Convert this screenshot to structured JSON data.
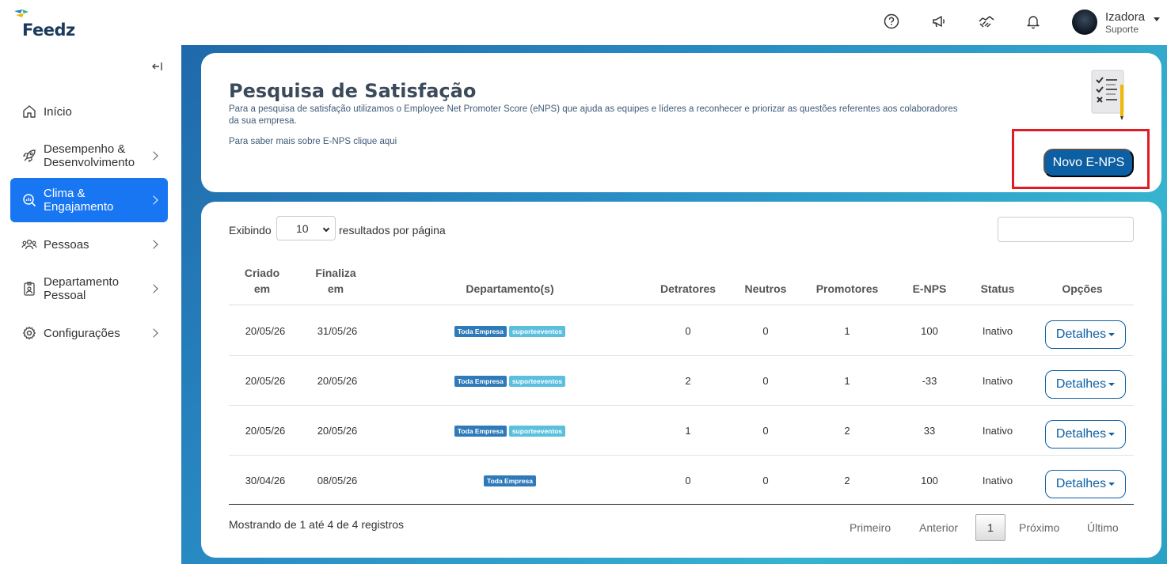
{
  "app": {
    "logo_text": "Feedz"
  },
  "header": {
    "icons": [
      "help-icon",
      "megaphone-icon",
      "handshake-icon",
      "bell-icon"
    ],
    "user": {
      "name": "Izadora",
      "role": "Suporte"
    }
  },
  "sidebar": {
    "collapse_icon": "collapse-left-icon",
    "items": [
      {
        "label": "Início",
        "icon": "home-icon",
        "active": false,
        "has_children": false
      },
      {
        "label": "Desempenho &\nDesenvolvimento",
        "icon": "rocket-icon",
        "active": false,
        "has_children": true
      },
      {
        "label": "Clima &\nEngajamento",
        "icon": "search-chart-icon",
        "active": true,
        "has_children": true
      },
      {
        "label": "Pessoas",
        "icon": "people-icon",
        "active": false,
        "has_children": true
      },
      {
        "label": "Departamento\nPessoal",
        "icon": "badge-icon",
        "active": false,
        "has_children": true
      },
      {
        "label": "Configurações",
        "icon": "gear-icon",
        "active": false,
        "has_children": true
      }
    ]
  },
  "page": {
    "title": "Pesquisa de Satisfação",
    "description": "Para a pesquisa de satisfação utilizamos o Employee Net Promoter Score (eNPS) que ajuda as equipes e líderes a reconhecer e priorizar as questões referentes aos colaboradores da sua empresa.",
    "more_link": "Para saber mais sobre E-NPS clique aqui",
    "new_button": "Novo E-NPS"
  },
  "table": {
    "show_label": "Exibindo",
    "page_size": "10",
    "per_page_label": "resultados por página",
    "search_value": "",
    "columns": [
      "Criado\nem",
      "Finaliza\nem",
      "Departamento(s)",
      "Detratores",
      "Neutros",
      "Promotores",
      "E-NPS",
      "Status",
      "Opções"
    ],
    "rows": [
      {
        "created": "20/05/26",
        "ends": "31/05/26",
        "departments": [
          "Toda Empresa",
          "suporteeventos"
        ],
        "detractors": "0",
        "neutrals": "0",
        "promoters": "1",
        "enps": "100",
        "status": "Inativo",
        "action": "Detalhes"
      },
      {
        "created": "20/05/26",
        "ends": "20/05/26",
        "departments": [
          "Toda Empresa",
          "suporteeventos"
        ],
        "detractors": "2",
        "neutrals": "0",
        "promoters": "1",
        "enps": "-33",
        "status": "Inativo",
        "action": "Detalhes"
      },
      {
        "created": "20/05/26",
        "ends": "20/05/26",
        "departments": [
          "Toda Empresa",
          "suporteeventos"
        ],
        "detractors": "1",
        "neutrals": "0",
        "promoters": "2",
        "enps": "33",
        "status": "Inativo",
        "action": "Detalhes"
      },
      {
        "created": "30/04/26",
        "ends": "08/05/26",
        "departments": [
          "Toda Empresa"
        ],
        "detractors": "0",
        "neutrals": "0",
        "promoters": "2",
        "enps": "100",
        "status": "Inativo",
        "action": "Detalhes"
      }
    ],
    "info": "Mostrando de 1 até 4 de 4 registros",
    "pagination": {
      "first": "Primeiro",
      "prev": "Anterior",
      "current": "1",
      "next": "Próximo",
      "last": "Último"
    }
  },
  "colors": {
    "primary": "#0d5fa3",
    "active_nav": "#1976f2",
    "highlight": "#e01b24",
    "tag_dark": "#2f7ab9",
    "tag_light": "#5bc0de"
  }
}
